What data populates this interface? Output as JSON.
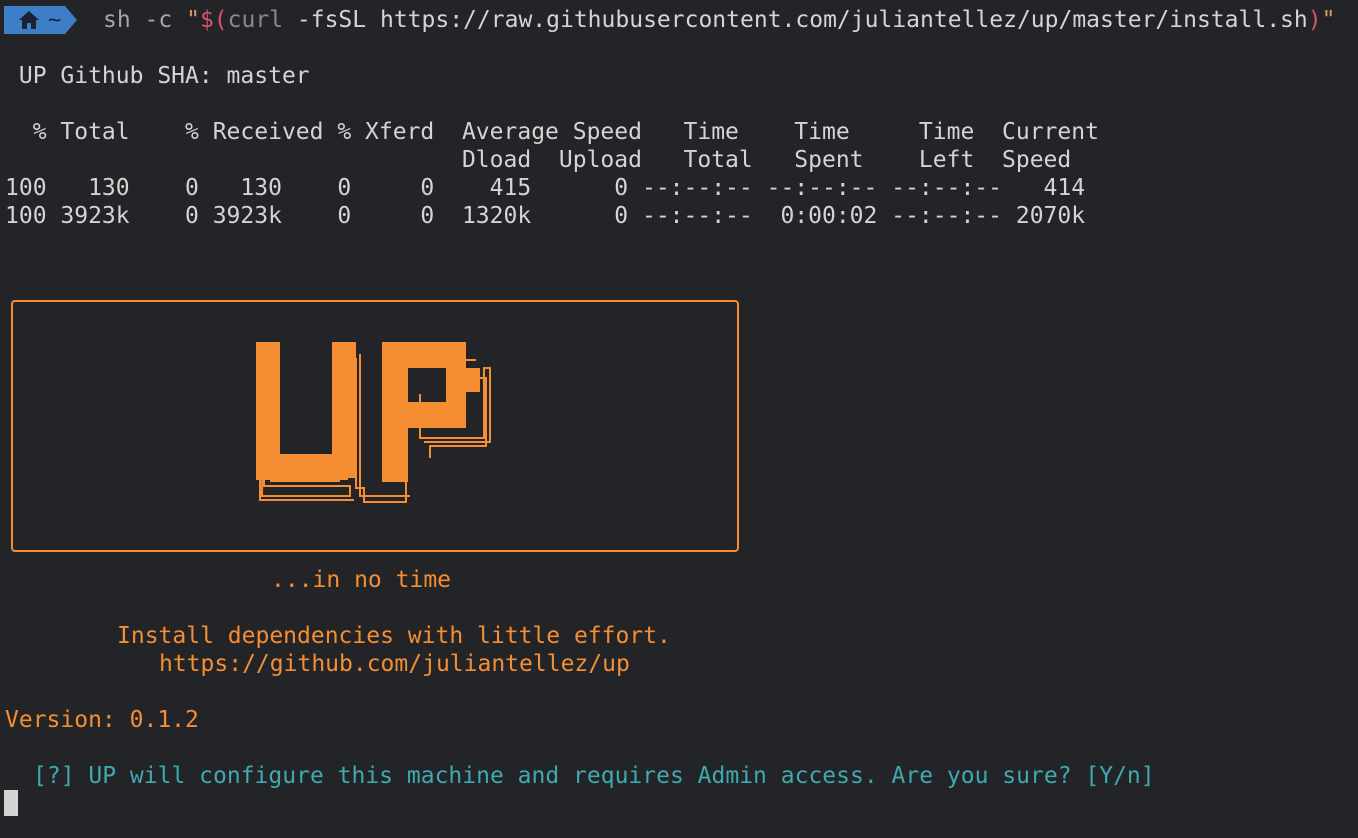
{
  "prompt": {
    "home_icon": "home-icon",
    "cwd": "~",
    "command_prefix": "sh -c ",
    "command_quote_open": "\"",
    "command_sub_open": "$(",
    "command_curl": "curl",
    "command_rest": " -fsSL https://raw.githubusercontent.com/juliantellez/up/master/install.sh",
    "command_sub_close": ")",
    "command_quote_close": "\""
  },
  "sha_line": " UP Github SHA: master",
  "curl_table": {
    "header1": "  % Total    % Received % Xferd  Average Speed   Time    Time     Time  Current",
    "header2": "                                 Dload  Upload   Total   Spent    Left  Speed",
    "row1": "100   130    0   130    0     0    415      0 --:--:-- --:--:-- --:--:--   414",
    "row2": "100 3923k    0 3923k    0     0  1320k      0 --:--:--  0:00:02 --:--:-- 2070k"
  },
  "banner": {
    "logo_text": "UP",
    "tagline": "...in no time",
    "description": "Install dependencies with little effort.",
    "url": "https://github.com/juliantellez/up"
  },
  "version_line": "Version: 0.1.2",
  "confirm_prompt": "[?] UP will configure this machine and requires Admin access. Are you sure? [Y/n]",
  "colors": {
    "background": "#232427",
    "accent_orange": "#f58e32",
    "prompt_teal": "#3fa9b0",
    "badge_blue": "#3d7ec6"
  }
}
